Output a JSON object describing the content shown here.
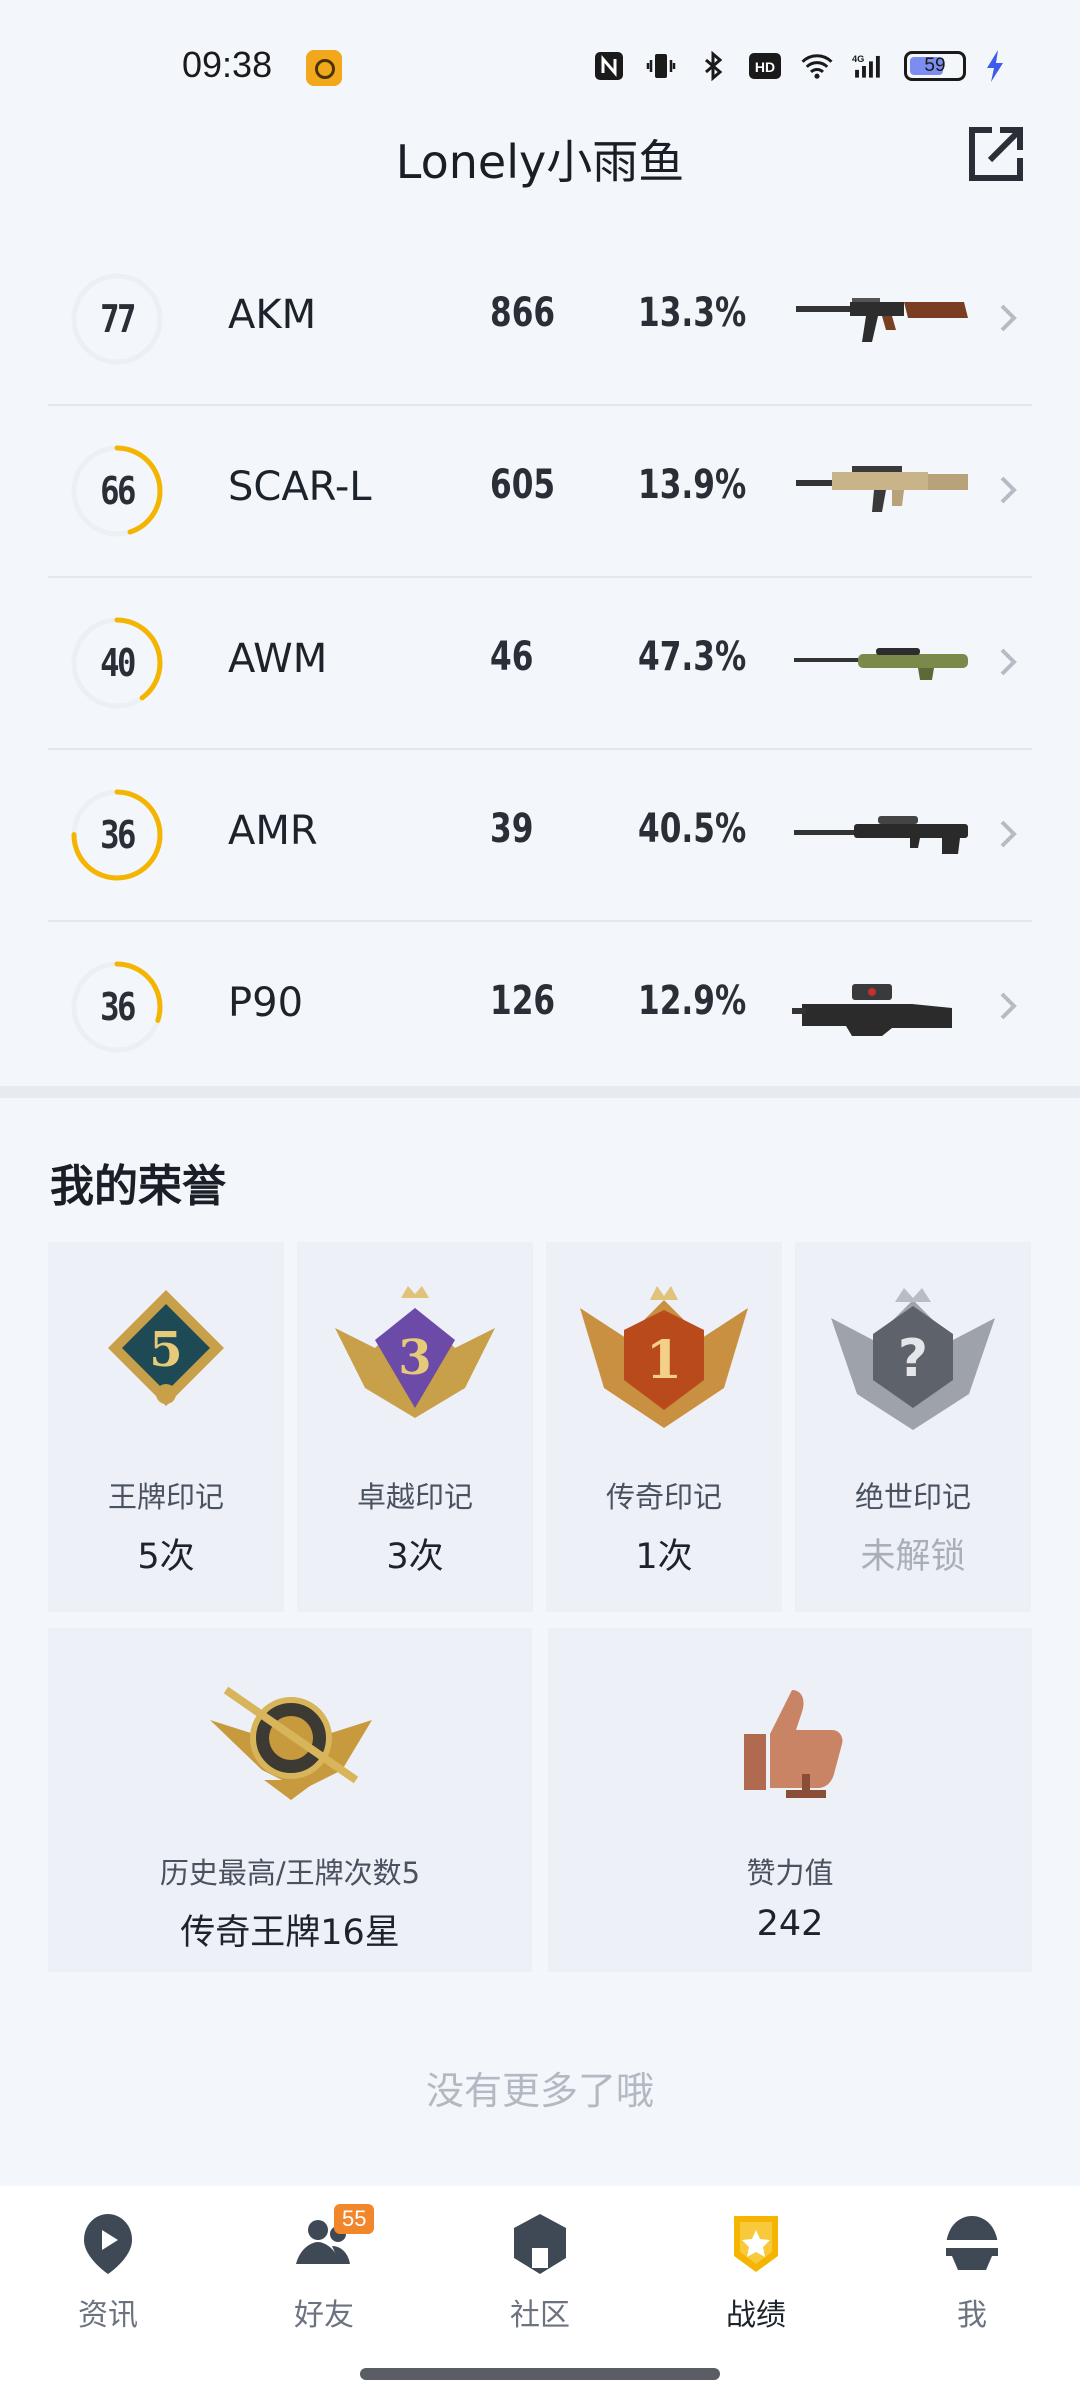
{
  "status_bar": {
    "time": "09:38",
    "battery": "59"
  },
  "header": {
    "title": "Lonely小雨鱼"
  },
  "weapons": [
    {
      "level": "77",
      "progress": 0.0,
      "name": "AKM",
      "kills": "866",
      "rate": "13.3%",
      "icon": "akm-rifle-icon"
    },
    {
      "level": "66",
      "progress": 0.45,
      "name": "SCAR-L",
      "kills": "605",
      "rate": "13.9%",
      "icon": "scar-l-rifle-icon"
    },
    {
      "level": "40",
      "progress": 0.4,
      "name": "AWM",
      "kills": "46",
      "rate": "47.3%",
      "icon": "awm-sniper-icon"
    },
    {
      "level": "36",
      "progress": 0.75,
      "name": "AMR",
      "kills": "39",
      "rate": "40.5%",
      "icon": "amr-sniper-icon"
    },
    {
      "level": "36",
      "progress": 0.3,
      "name": "P90",
      "kills": "126",
      "rate": "12.9%",
      "icon": "p90-smg-icon"
    }
  ],
  "honor": {
    "title": "我的荣誉",
    "badges": [
      {
        "label": "王牌印记",
        "value": "5次",
        "icon": "ace-mark-badge-icon",
        "emblem": "5",
        "locked": false
      },
      {
        "label": "卓越印记",
        "value": "3次",
        "icon": "excellence-mark-badge-icon",
        "emblem": "3",
        "locked": false
      },
      {
        "label": "传奇印记",
        "value": "1次",
        "icon": "legend-mark-badge-icon",
        "emblem": "1",
        "locked": false
      },
      {
        "label": "绝世印记",
        "value": "未解锁",
        "icon": "peerless-mark-badge-icon",
        "emblem": "?",
        "locked": true
      }
    ],
    "rank_card": {
      "label": "历史最高/王牌次数5",
      "value": "传奇王牌16星",
      "icon": "legend-ace-rank-icon"
    },
    "likes_card": {
      "label": "赞力值",
      "value": "242",
      "icon": "thumbs-up-icon"
    }
  },
  "no_more": "没有更多了哦",
  "nav": {
    "items": [
      {
        "label": "资讯",
        "icon": "news-icon"
      },
      {
        "label": "好友",
        "icon": "friends-icon",
        "badge": "55"
      },
      {
        "label": "社区",
        "icon": "community-icon"
      },
      {
        "label": "战绩",
        "icon": "record-icon",
        "active": true
      },
      {
        "label": "我",
        "icon": "me-helmet-icon"
      }
    ]
  },
  "colors": {
    "accent": "#f4b400",
    "ring_track": "#eceff4",
    "badge_orange": "#f2862b"
  }
}
